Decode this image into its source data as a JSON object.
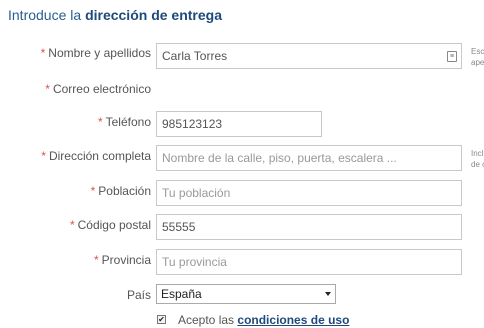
{
  "header": {
    "title_prefix": "Introduce la",
    "title_strong": "dirección de entrega"
  },
  "form": {
    "required_mark": "*",
    "name": {
      "label": "Nombre y apellidos",
      "value": "Carla Torres",
      "hint_line1": "Esc",
      "hint_line2": "ape"
    },
    "email": {
      "label": "Correo electrónico"
    },
    "phone": {
      "label": "Teléfono",
      "value": "985123123"
    },
    "address": {
      "label": "Dirección completa",
      "placeholder": "Nombre de la calle, piso, puerta, escalera ...",
      "hint_line1": "Incl",
      "hint_line2": "de c"
    },
    "city": {
      "label": "Población",
      "placeholder": "Tu población"
    },
    "postal": {
      "label": "Código postal",
      "value": "55555"
    },
    "province": {
      "label": "Provincia",
      "placeholder": "Tu provincia"
    },
    "country": {
      "label": "País",
      "selected": "España"
    },
    "terms": {
      "checked": true,
      "check_glyph": "✔",
      "prefix": "Acepto las",
      "link": "condiciones de uso"
    }
  }
}
